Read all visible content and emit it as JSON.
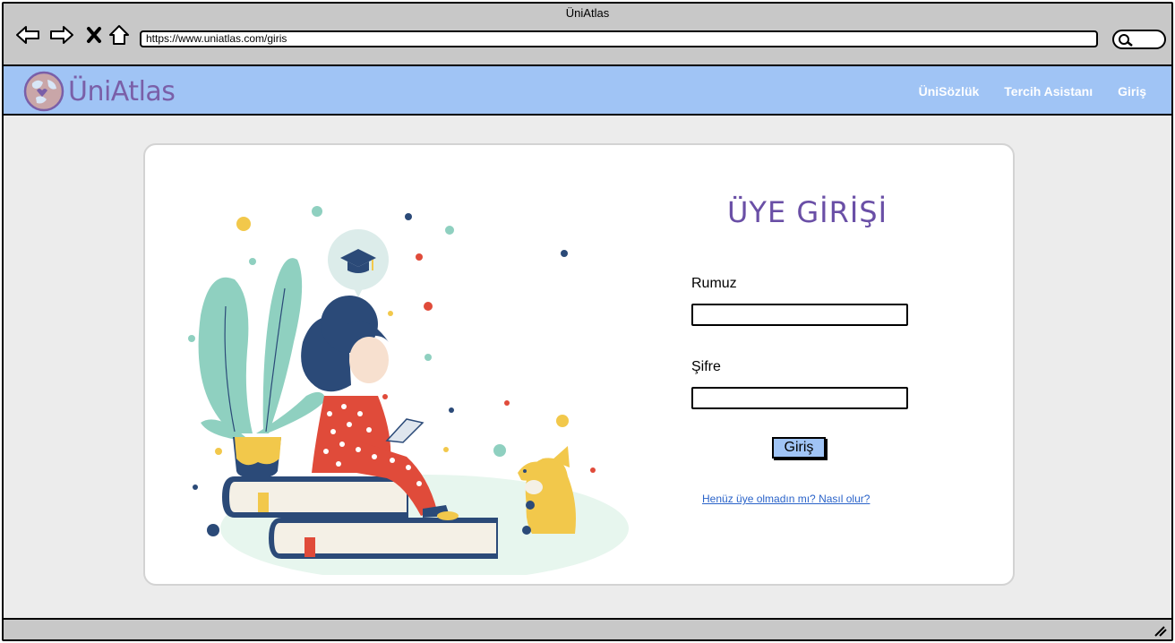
{
  "window": {
    "title": "ÜniAtlas"
  },
  "browser": {
    "back_icon": "arrow-left",
    "forward_icon": "arrow-right",
    "close_icon": "x",
    "home_icon": "house",
    "url": "https://www.uniatlas.com/giris",
    "search_icon": "magnifier"
  },
  "navbar": {
    "logo_text": "ÜniAtlas",
    "links": [
      "ÜniSözlük",
      "Tercih Asistanı",
      "Giriş"
    ],
    "color": "#a0c4f5"
  },
  "login": {
    "title": "ÜYE GİRİŞİ",
    "username_label": "Rumuz",
    "username_value": "",
    "password_label": "Şifre",
    "password_value": "",
    "submit_label": "Giriş",
    "signup_link": "Henüz üye olmadın mı? Nasıl olur?",
    "accent": "#6a4fa6"
  }
}
